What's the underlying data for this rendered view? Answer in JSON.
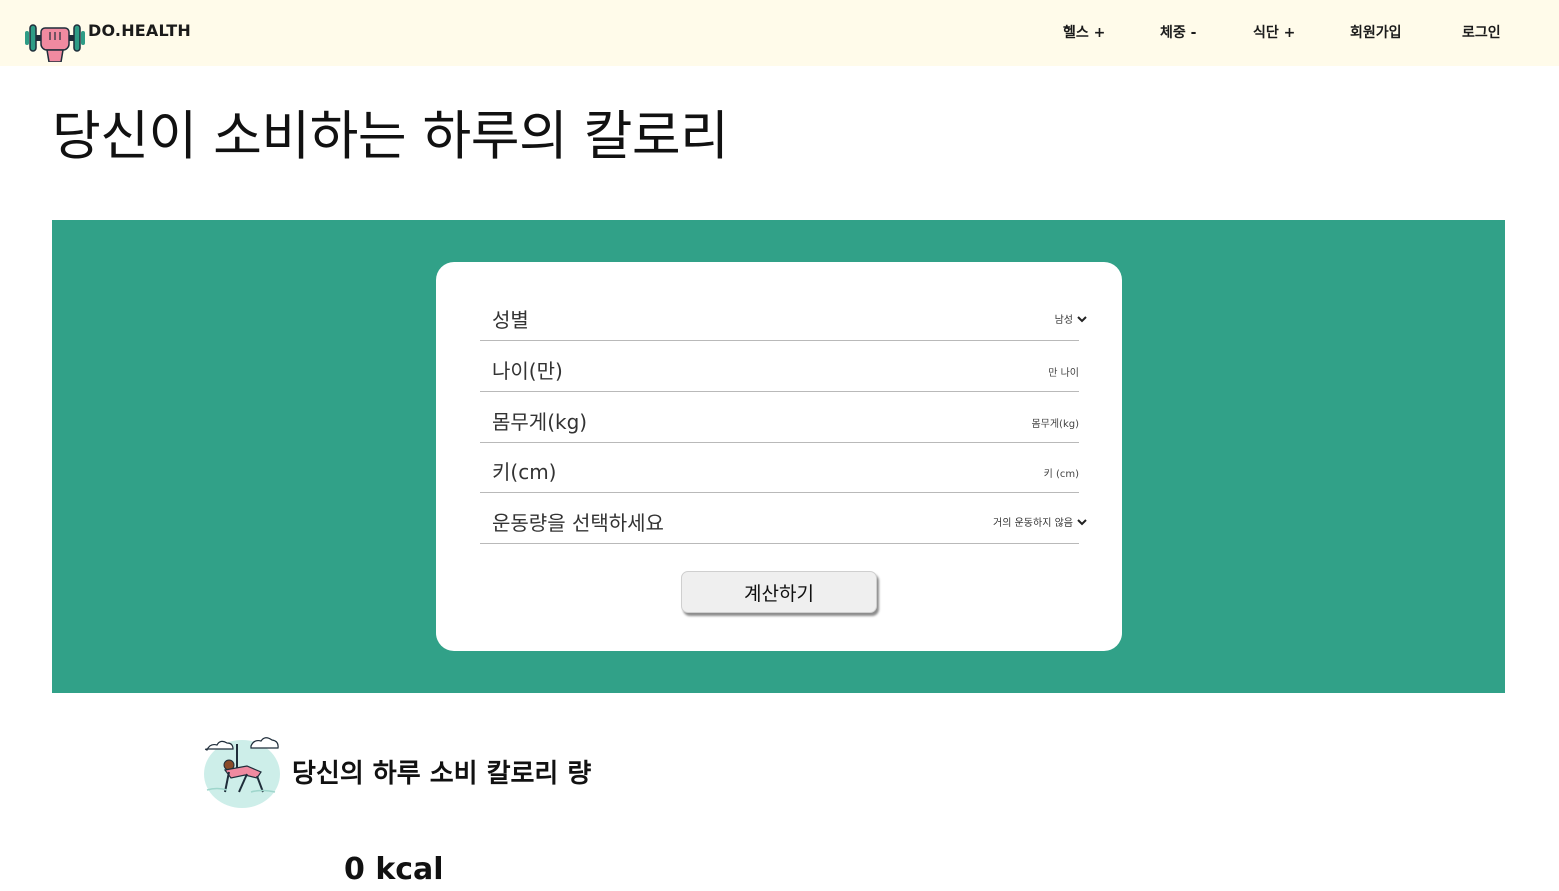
{
  "brand": {
    "name": "DO.HEALTH",
    "logo_icon": "dumbbell-fist-icon"
  },
  "nav": {
    "items": [
      {
        "label": "헬스 +"
      },
      {
        "label": "체중 -"
      },
      {
        "label": "식단 +"
      },
      {
        "label": "회원가입"
      },
      {
        "label": "로그인"
      }
    ]
  },
  "page": {
    "title": "당신이 소비하는 하루의 칼로리"
  },
  "form": {
    "gender": {
      "label": "성별",
      "value": "남성"
    },
    "age": {
      "label": "나이(만)",
      "placeholder": "만 나이"
    },
    "weight": {
      "label": "몸무게(kg)",
      "placeholder": "몸무게(kg)"
    },
    "height": {
      "label": "키(cm)",
      "placeholder": "키 (cm)"
    },
    "activity": {
      "label": "운동량을 선택하세요",
      "value": "거의 운동하지 않음"
    },
    "submit_label": "계산하기"
  },
  "result": {
    "icon": "yoga-woman-icon",
    "title": "당신의 하루 소비 칼로리 량",
    "value": "0 kcal"
  },
  "colors": {
    "navbar_bg": "#fffbea",
    "band_bg": "#31a188",
    "card_bg": "#ffffff"
  }
}
